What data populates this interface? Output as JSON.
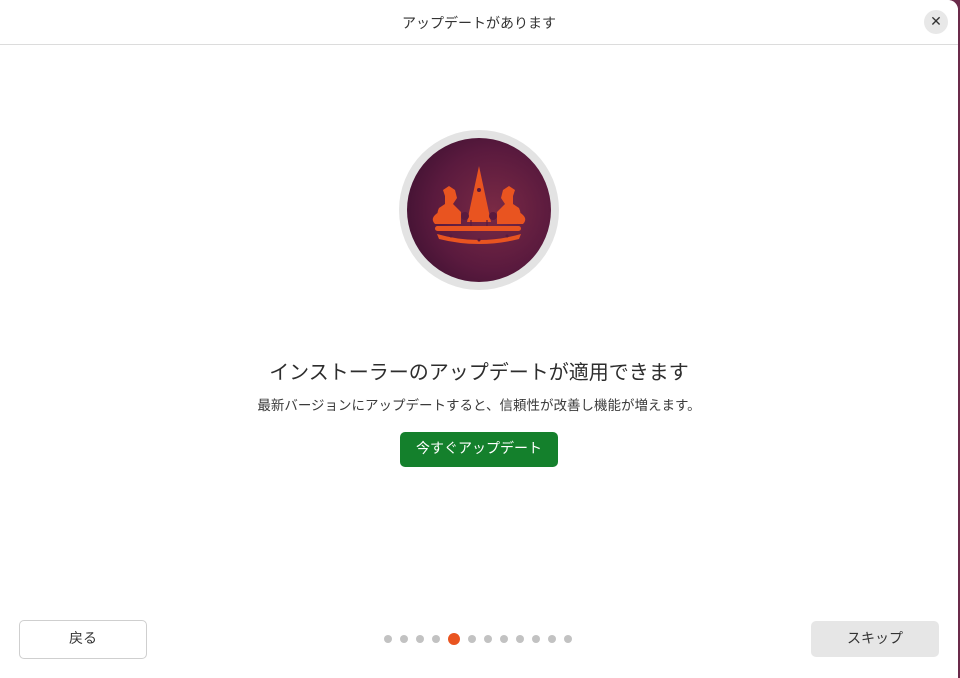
{
  "window": {
    "title": "アップデートがあります",
    "close_icon": "close-icon"
  },
  "main": {
    "emblem_icon": "ubuntu-crown-emblem-icon",
    "heading": "インストーラーのアップデートが適用できます",
    "description": "最新バージョンにアップデートすると、信頼性が改善し機能が増えます。",
    "update_button_label": "今すぐアップデート"
  },
  "footer": {
    "back_label": "戻る",
    "skip_label": "スキップ",
    "pagination": {
      "total_pages": 12,
      "current_page": 5
    }
  },
  "colors": {
    "accent": "#E95420",
    "primary_button": "#14802C",
    "emblem_background": "#5A1A3E"
  }
}
